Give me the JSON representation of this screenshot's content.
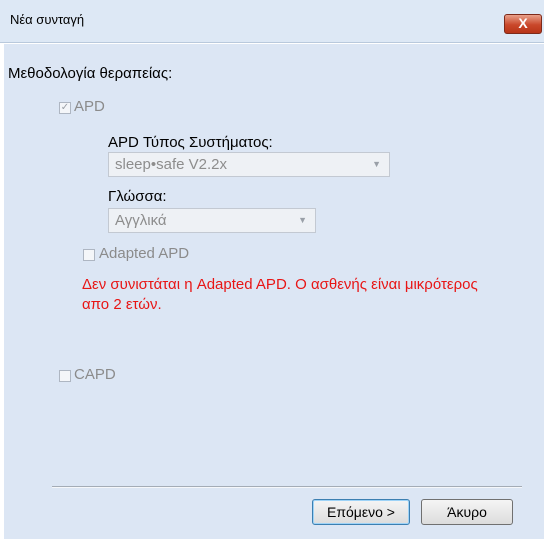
{
  "window": {
    "title": "Νέα συνταγή",
    "close_label": "X"
  },
  "methodology_label": "Μεθοδολογία θεραπείας:",
  "apd": {
    "checked": true,
    "check_mark": "✓",
    "label": "APD",
    "system_type_label": "APD Τύπος Συστήματος:",
    "system_type_value": "sleep•safe V2.2x",
    "language_label": "Γλώσσα:",
    "language_value": "Αγγλικά"
  },
  "adapted_apd": {
    "checked": false,
    "label": "Adapted APD",
    "warning_line1": "Δεν συνιστάται η Adapted APD. Ο ασθενής είναι μικρότερος",
    "warning_line2": "απο 2 ετών."
  },
  "capd": {
    "checked": false,
    "label": "CAPD"
  },
  "buttons": {
    "next": "Επόμενο >",
    "cancel": "Άκυρο"
  },
  "colors": {
    "panel": "#dce6f4",
    "warning": "#e81515",
    "close_button": "#c9472a"
  }
}
